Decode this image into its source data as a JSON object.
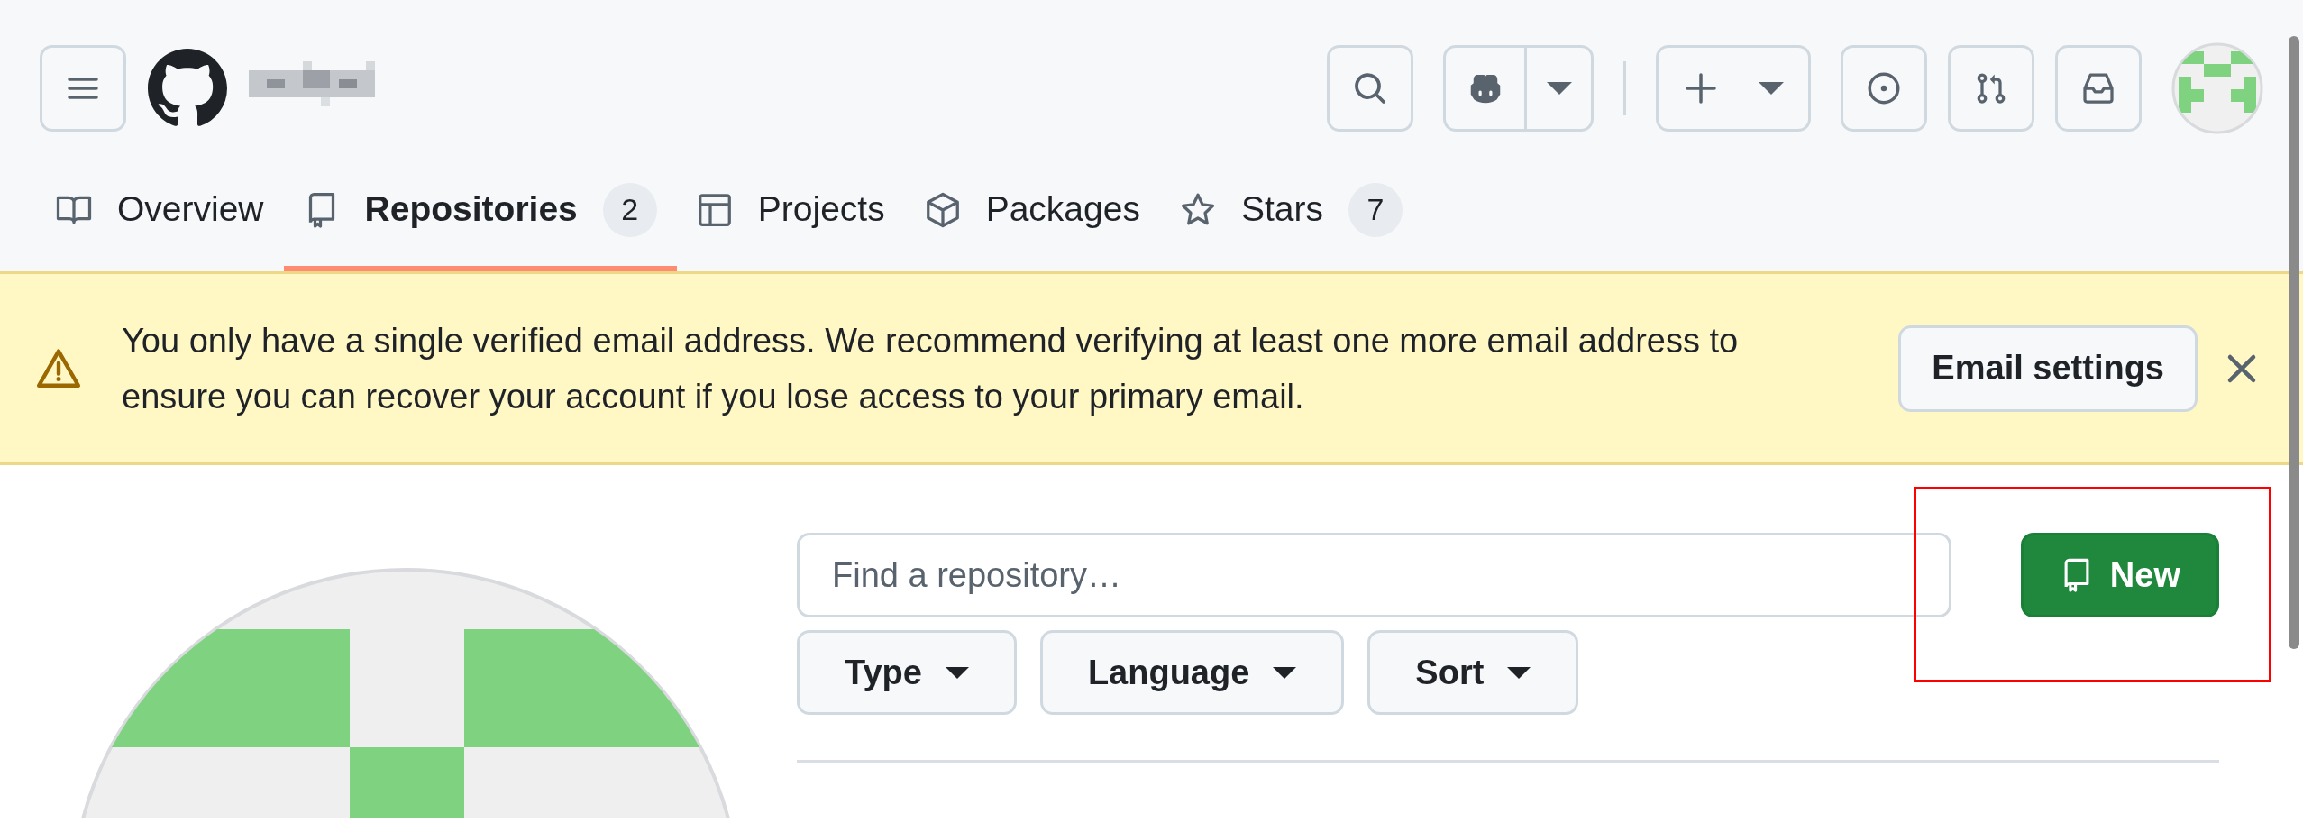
{
  "tabs": [
    {
      "label": "Overview",
      "selected": false
    },
    {
      "label": "Repositories",
      "count": "2",
      "selected": true
    },
    {
      "label": "Projects",
      "selected": false
    },
    {
      "label": "Packages",
      "selected": false
    },
    {
      "label": "Stars",
      "count": "7",
      "selected": false
    }
  ],
  "banner": {
    "message": "You only have a single verified email address. We recommend verifying at least one more email address to ensure you can recover your account if you lose access to your primary email.",
    "button": "Email settings"
  },
  "search": {
    "placeholder": "Find a repository…"
  },
  "filters": [
    {
      "label": "Type"
    },
    {
      "label": "Language"
    },
    {
      "label": "Sort"
    }
  ],
  "new_button": "New"
}
